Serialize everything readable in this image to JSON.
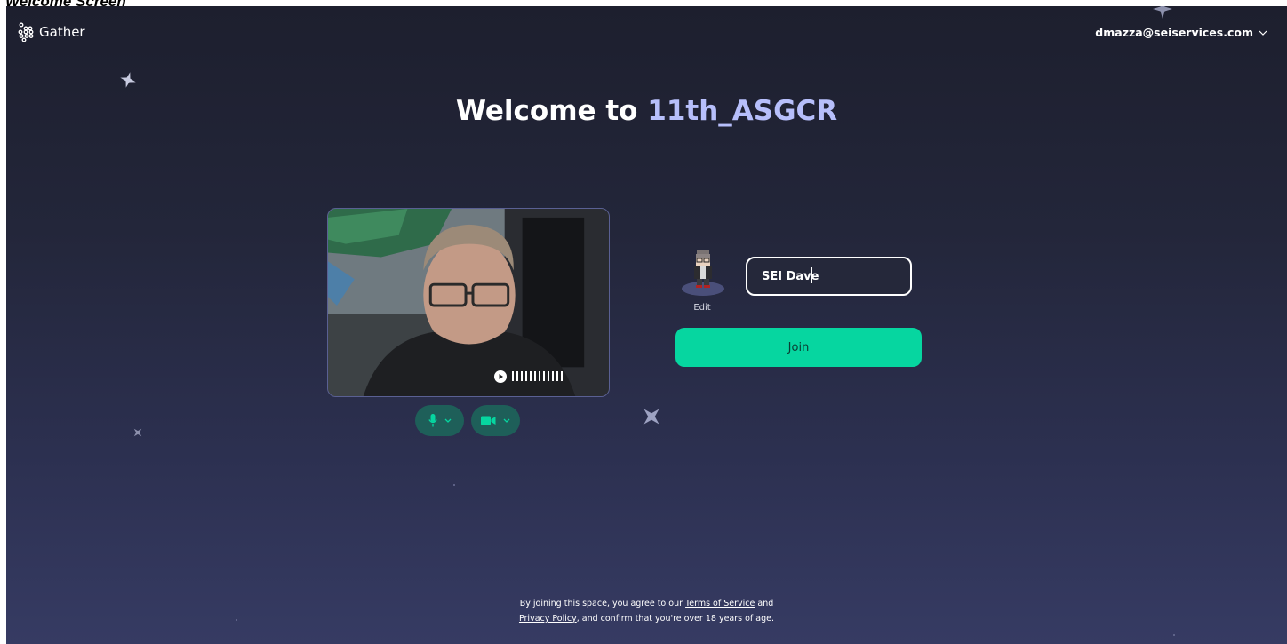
{
  "caption": "Welcome Screen",
  "brand": {
    "name": "Gather",
    "icon": "gather-logo-icon"
  },
  "account": {
    "email": "dmazza@seiservices.com",
    "icon": "chevron-down-icon"
  },
  "welcome": {
    "prefix": "Welcome to",
    "space_name": "11th_ASGCR"
  },
  "video_preview": {
    "play_icon": "play-icon",
    "mic_icon": "microphone-icon",
    "camera_icon": "video-camera-icon",
    "dropdown_icon": "chevron-down-icon"
  },
  "avatar": {
    "edit_label": "Edit"
  },
  "name_input": {
    "value": "SEI Dave"
  },
  "join_button": {
    "label": "Join"
  },
  "legal": {
    "line1_prefix": "By joining this space, you agree to our",
    "terms_link": "Terms of Service",
    "line1_suffix": "and",
    "privacy_link": "Privacy Policy",
    "line2_suffix": ", and confirm that you're over 18 years of age."
  },
  "colors": {
    "background_top": "#1d1f2e",
    "background_bottom": "#363b63",
    "accent": "#06d6a0",
    "space_name": "#b7bffb",
    "control_pill": "#1e5f59"
  }
}
